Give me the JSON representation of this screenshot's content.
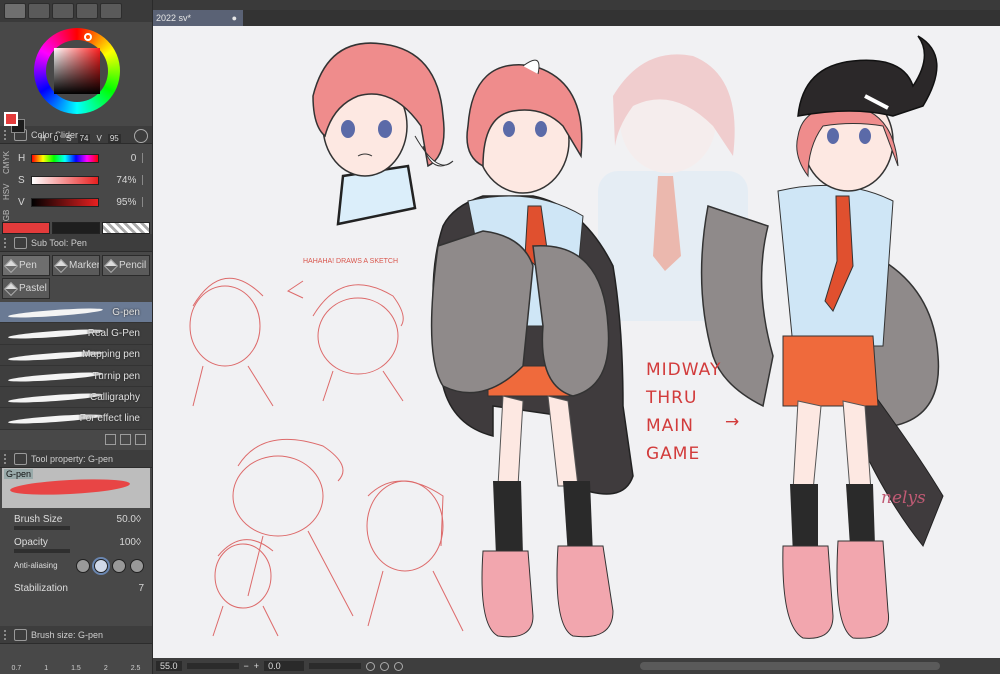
{
  "document": {
    "tab_title": "2022 sv*",
    "close_glyph": "●"
  },
  "color_wheel": {
    "h_label": "H",
    "h": "0",
    "s_label": "S",
    "s": "74",
    "v_label": "V",
    "v": "95",
    "main_color": "#e33b3b",
    "sub_color": "#1c1c1c"
  },
  "color_slider": {
    "title": "Color Slider",
    "modes": [
      "RGB",
      "HSV",
      "CMYK"
    ],
    "rows": [
      {
        "label": "H",
        "value": "0"
      },
      {
        "label": "S",
        "value": "74%"
      },
      {
        "label": "V",
        "value": "95%"
      }
    ]
  },
  "sub_tool": {
    "title": "Sub Tool: Pen",
    "tabs": [
      "Pen",
      "Marker",
      "Pencil",
      "Pastel"
    ],
    "brushes": [
      "G-pen",
      "Real G-Pen",
      "Mapping pen",
      "Turnip pen",
      "Calligraphy",
      "For effect line"
    ]
  },
  "tool_property": {
    "title": "Tool property: G-pen",
    "preview_name": "G-pen",
    "brush_size_label": "Brush Size",
    "brush_size": "50.0",
    "opacity_label": "Opacity",
    "opacity": "100",
    "anti_alias_label": "Anti-aliasing",
    "stabilization_label": "Stabilization",
    "stabilization": "7"
  },
  "brush_size_panel": {
    "title": "Brush size: G-pen",
    "sizes": [
      "0.7",
      "1",
      "1.5",
      "2",
      "2.5"
    ]
  },
  "status": {
    "zoom": "55.0",
    "minus": "−",
    "plus": "+",
    "angle": "0.0"
  },
  "canvas": {
    "annotation_lines": [
      "MIDWAY",
      "THRU",
      "MAIN",
      "GAME"
    ],
    "sketch_note": "HAHAHA! DRAWS A SKETCH",
    "signature": "nelys"
  },
  "colors": {
    "hair": "#ef8c8c",
    "hair_dark": "#d86a72",
    "shirt": "#cfe6f6",
    "tie": "#e0502f",
    "jacket": "#8f8a8a",
    "jacket_dark": "#3f3b3d",
    "shorts": "#ef6a3c",
    "shoe": "#f2a6ae",
    "sketch": "#dd6a6a"
  }
}
